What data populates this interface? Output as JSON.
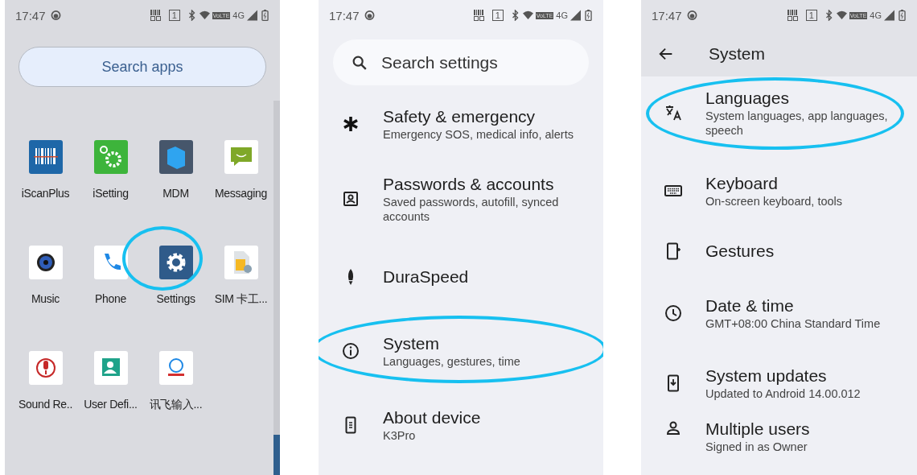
{
  "screens": [
    {
      "status_bar": {
        "time": "17:47",
        "sim_slot": "1",
        "volte": "VoLTE",
        "network": "4G"
      },
      "search": {
        "placeholder": "Search apps"
      },
      "apps": [
        {
          "label": "iScanPlus",
          "highlighted": false
        },
        {
          "label": "iSetting",
          "highlighted": false
        },
        {
          "label": "MDM",
          "highlighted": false
        },
        {
          "label": "Messaging",
          "highlighted": false
        },
        {
          "label": "Music",
          "highlighted": false
        },
        {
          "label": "Phone",
          "highlighted": false
        },
        {
          "label": "Settings",
          "highlighted": true
        },
        {
          "label": "SIM 卡工...",
          "highlighted": false
        },
        {
          "label": "Sound Re..",
          "highlighted": false
        },
        {
          "label": "User Defi...",
          "highlighted": false
        },
        {
          "label": "讯飞输入...",
          "highlighted": false
        }
      ]
    },
    {
      "status_bar": {
        "time": "17:47",
        "sim_slot": "1",
        "volte": "VoLTE",
        "network": "4G"
      },
      "search": {
        "placeholder": "Search settings"
      },
      "items": [
        {
          "title": "Safety & emergency",
          "subtitle": "Emergency SOS, medical info, alerts",
          "highlighted": false
        },
        {
          "title": "Passwords & accounts",
          "subtitle": "Saved passwords, autofill, synced accounts",
          "highlighted": false
        },
        {
          "title": "DuraSpeed",
          "highlighted": false
        },
        {
          "title": "System",
          "subtitle": "Languages, gestures, time",
          "highlighted": true
        },
        {
          "title": "About device",
          "subtitle": "K3Pro",
          "highlighted": false
        }
      ]
    },
    {
      "status_bar": {
        "time": "17:47",
        "sim_slot": "1",
        "volte": "VoLTE",
        "network": "4G"
      },
      "title": "System",
      "items": [
        {
          "title": "Languages",
          "subtitle": "System languages, app languages, speech",
          "highlighted": true
        },
        {
          "title": "Keyboard",
          "subtitle": "On-screen keyboard, tools",
          "highlighted": false
        },
        {
          "title": "Gestures",
          "highlighted": false
        },
        {
          "title": "Date & time",
          "subtitle": "GMT+08:00 China Standard Time",
          "highlighted": false
        },
        {
          "title": "System updates",
          "subtitle": "Updated to Android 14.00.012",
          "highlighted": false
        },
        {
          "title": "Multiple users",
          "subtitle": "Signed in as Owner",
          "highlighted": false
        }
      ]
    }
  ]
}
